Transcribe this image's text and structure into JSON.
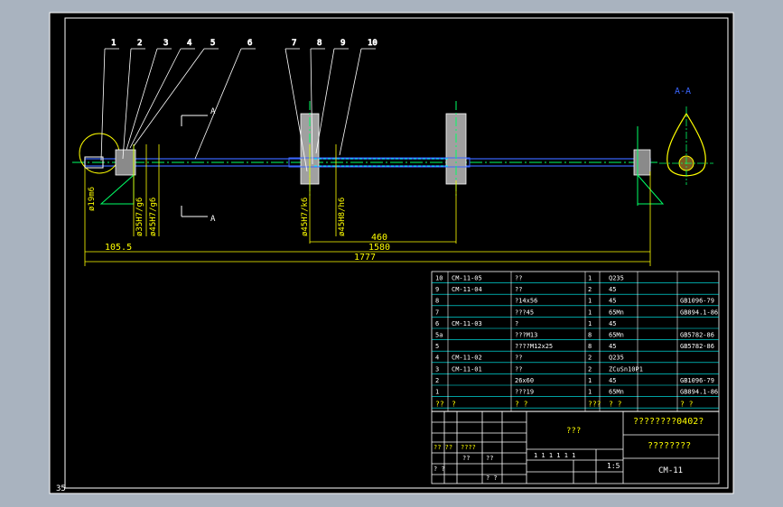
{
  "balloons": [
    "1",
    "2",
    "3",
    "4",
    "5",
    "6",
    "7",
    "8",
    "9",
    "10"
  ],
  "section_label": "A-A",
  "section_marker": "A",
  "dims": {
    "d19": "ø19m6",
    "d35": "ø35H7/g6",
    "d45a": "ø45H7/g6",
    "d45b": "ø45H7/k6",
    "d45c": "ø45H8/h6",
    "len460": "460",
    "len1580": "1580",
    "len1777": "1777",
    "len105": "105.5"
  },
  "bom": [
    {
      "no": "10",
      "code": "CM-11-05",
      "name": "??",
      "qty": "1",
      "mat": "Q235",
      "std": ""
    },
    {
      "no": "9",
      "code": "CM-11-04",
      "name": "??",
      "qty": "2",
      "mat": "45",
      "std": ""
    },
    {
      "no": "8",
      "code": "",
      "name": "?14x56",
      "qty": "1",
      "mat": "45",
      "std": "GB1096-79"
    },
    {
      "no": "7",
      "code": "",
      "name": "???45",
      "qty": "1",
      "mat": "65Mn",
      "std": "GB894.1-86"
    },
    {
      "no": "6",
      "code": "CM-11-03",
      "name": "?",
      "qty": "1",
      "mat": "45",
      "std": ""
    },
    {
      "no": "5a",
      "code": "",
      "name": "???M13",
      "qty": "8",
      "mat": "65Mn",
      "std": "GB5782-86"
    },
    {
      "no": "5",
      "code": "",
      "name": "????M12x25",
      "qty": "8",
      "mat": "45",
      "std": "GB5782-86"
    },
    {
      "no": "4",
      "code": "CM-11-02",
      "name": "??",
      "qty": "2",
      "mat": "Q235",
      "std": ""
    },
    {
      "no": "3",
      "code": "CM-11-01",
      "name": "??",
      "qty": "2",
      "mat": "ZCuSn10P1",
      "std": ""
    },
    {
      "no": "2",
      "code": "",
      "name": "26x60",
      "qty": "1",
      "mat": "45",
      "std": "GB1096-79"
    },
    {
      "no": "1",
      "code": "",
      "name": "???19",
      "qty": "1",
      "mat": "65Mn",
      "std": "GB894.1-86"
    }
  ],
  "bom_header": {
    "no": "??",
    "code": "?",
    "name": "? ?",
    "qty": "???",
    "mat": "? ?",
    "std": "? ?"
  },
  "title_block": {
    "part_name": "???",
    "school": "????????0402?",
    "org": "????????",
    "drawing_no": "CM-11",
    "scale": "1:5",
    "sheet": "1 1 1 1 1 1",
    "small1": "?? ??",
    "small2": "????",
    "small3": "??",
    "small4": "? ?",
    "small5": "??",
    "small6": "? ?"
  },
  "corner_number": "35"
}
